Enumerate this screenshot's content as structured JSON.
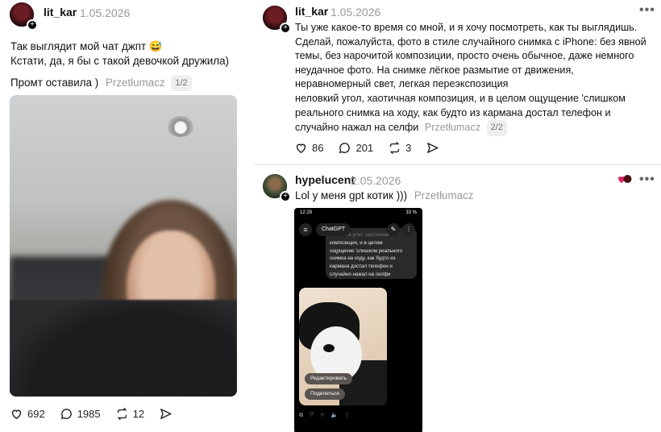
{
  "left_post": {
    "username": "lit_kar",
    "date": "1.05.2026",
    "text_line1": "Так выглядит мой чат джпт 😅",
    "text_line2": "Кстати, да, я бы с такой девочкой дружила)",
    "text_line3": "Промт оставила )",
    "translate": "Przetłumacz",
    "pager": "1/2",
    "likes": "692",
    "comments": "1985",
    "reposts": "12",
    "icons": [
      "heart-icon",
      "comment-icon",
      "repost-icon",
      "share-icon"
    ]
  },
  "right_post": {
    "username": "lit_kar",
    "date": "1.05.2026",
    "more": "•••",
    "lines": [
      "Ты уже какое-то время со мной, и я хочу посмотреть, как ты выглядишь.",
      "Сделай, пожалуйста, фото в стиле случайного снимка с iPhone: без явной",
      "темы, без нарочитой композиции, просто очень обычное, даже немного",
      "неудачное фото. На снимке лёгкое размытие от движения,",
      "неравномерный свет, легкая переэкспозиция",
      "неловкий угол, хаотичная композиция, и в целом ощущение 'слишком",
      "реального снимка на ходу, как будто из кармана достал телефон и"
    ],
    "last_line": "случайно нажал на селфи",
    "translate": "Przetłumacz",
    "pager": "2/2",
    "likes": "86",
    "comments": "201",
    "reposts": "3"
  },
  "reply_post": {
    "username": "hypelucent",
    "date": "2.05.2026",
    "more": "•••",
    "text": "Lol у меня gpt котик )))",
    "translate": "Przetłumacz",
    "phone": {
      "time": "12:28",
      "battery": "33 %",
      "model_label": "ChatGPT",
      "bubble_faded": "неловкий угол, хаотичная",
      "bubble_lines": [
        "неловкий угол, хаотичная",
        "композиция, и в целом",
        "ощущение 'слишком реального",
        "снимка на ходу, как будто из",
        "кармана достал телефон и",
        "случайно нажал на селфи"
      ],
      "edit_chip": "Редактировать",
      "share_chip": "Поделиться"
    }
  },
  "colors": {
    "muted": "#999999",
    "text": "#111111",
    "accent_heart": "#e0245e"
  }
}
